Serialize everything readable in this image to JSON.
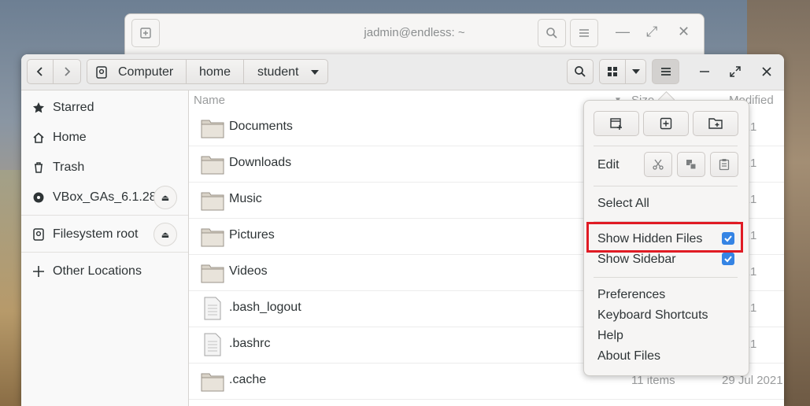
{
  "background_window": {
    "title": "jadmin@endless: ~"
  },
  "path_bar": {
    "items": [
      "Computer",
      "home",
      "student"
    ]
  },
  "sidebar": {
    "items": [
      {
        "label": "Starred",
        "icon": "star-icon"
      },
      {
        "label": "Home",
        "icon": "home-icon"
      },
      {
        "label": "Trash",
        "icon": "trash-icon"
      },
      {
        "label": "VBox_GAs_6.1.28",
        "icon": "disc-icon",
        "eject": true
      },
      {
        "label": "Filesystem root",
        "icon": "drive-icon",
        "eject": true
      },
      {
        "label": "Other Locations",
        "icon": "plus-icon"
      }
    ]
  },
  "columns": {
    "name": "Name",
    "size": "Size",
    "modified": "Modified"
  },
  "files": [
    {
      "name": "Documents",
      "type": "folder",
      "modified": "2021"
    },
    {
      "name": "Downloads",
      "type": "folder",
      "modified": "2021"
    },
    {
      "name": "Music",
      "type": "folder",
      "modified": "2021"
    },
    {
      "name": "Pictures",
      "type": "folder",
      "modified": "2021"
    },
    {
      "name": "Videos",
      "type": "folder",
      "modified": "2021"
    },
    {
      "name": ".bash_logout",
      "type": "file",
      "modified": "2021"
    },
    {
      "name": ".bashrc",
      "type": "file",
      "modified": "2021"
    },
    {
      "name": ".cache",
      "type": "folder",
      "size": "11 items",
      "modified": "29 Jul 2021"
    }
  ],
  "menu": {
    "edit_label": "Edit",
    "select_all": "Select All",
    "show_hidden_files": "Show Hidden Files",
    "show_sidebar": "Show Sidebar",
    "show_hidden_checked": true,
    "show_sidebar_checked": true,
    "preferences": "Preferences",
    "keyboard_shortcuts": "Keyboard Shortcuts",
    "help": "Help",
    "about": "About Files"
  },
  "colors": {
    "accent": "#3584e4",
    "highlight": "#e01b24"
  }
}
